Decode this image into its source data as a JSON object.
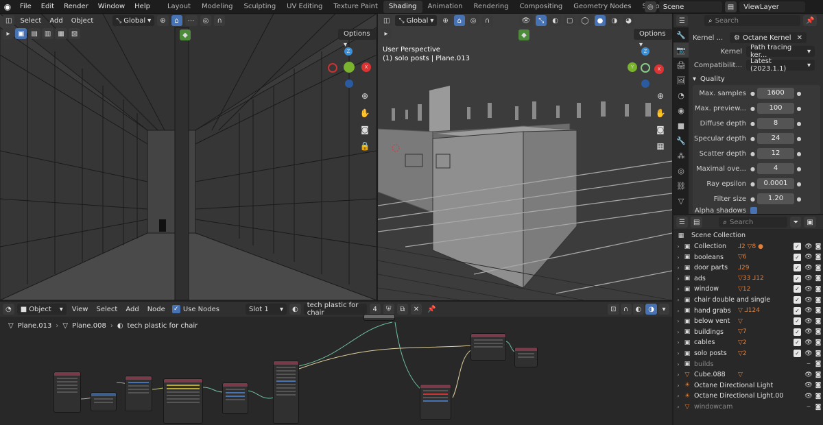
{
  "menu": {
    "items": [
      "File",
      "Edit",
      "Render",
      "Window",
      "Help"
    ]
  },
  "workspaces": {
    "tabs": [
      "Layout",
      "Modeling",
      "Sculpting",
      "UV Editing",
      "Texture Paint",
      "Shading",
      "Animation",
      "Rendering",
      "Compositing",
      "Geometry Nodes",
      "Scripting"
    ],
    "active": "Shading"
  },
  "scene": {
    "name": "Scene",
    "viewlayer": "ViewLayer"
  },
  "viewport_left": {
    "modes": [
      "Select",
      "Add",
      "Object"
    ],
    "orientation": "Global",
    "options_label": "Options"
  },
  "viewport_right": {
    "orientation": "Global",
    "options_label": "Options",
    "overlay_title": "User Perspective",
    "overlay_subtitle": "(1) solo posts | Plane.013"
  },
  "properties": {
    "search_placeholder": "Search",
    "kernel_label": "Kernel ...",
    "kernel_node": "Octane Kernel",
    "kernel_type_label": "Kernel",
    "kernel_type_value": "Path tracing ker...",
    "compat_label": "Compatibilit...",
    "compat_value": "Latest (2023.1.1)",
    "section_title": "Quality",
    "rows": [
      {
        "label": "Max. samples",
        "value": "1600"
      },
      {
        "label": "Max. preview...",
        "value": "100"
      },
      {
        "label": "Diffuse depth",
        "value": "8"
      },
      {
        "label": "Specular depth",
        "value": "24"
      },
      {
        "label": "Scatter depth",
        "value": "12"
      },
      {
        "label": "Maximal ove...",
        "value": "4"
      },
      {
        "label": "Ray epsilon",
        "value": "0.0001"
      },
      {
        "label": "Filter size",
        "value": "1.20"
      }
    ],
    "last_row": "Alpha shadows"
  },
  "outliner": {
    "search_placeholder": "Search",
    "root": "Scene Collection",
    "items": [
      {
        "name": "Collection",
        "extra": "⅃2 ▽8 ●",
        "dim": false,
        "checkbox": true
      },
      {
        "name": "booleans",
        "extra": "▽6",
        "dim": false,
        "checkbox": true
      },
      {
        "name": "door parts",
        "extra": "⅃29",
        "dim": false,
        "checkbox": true
      },
      {
        "name": "ads",
        "extra": "▽33 ⅃12",
        "dim": false,
        "checkbox": true
      },
      {
        "name": "window",
        "extra": "▽12",
        "dim": false,
        "checkbox": true
      },
      {
        "name": "chair double and single",
        "extra": "",
        "dim": false,
        "checkbox": true
      },
      {
        "name": "hand grabs",
        "extra": "▽ ⅃124",
        "dim": false,
        "checkbox": true
      },
      {
        "name": "below vent",
        "extra": "▽",
        "dim": false,
        "checkbox": true
      },
      {
        "name": "buildings",
        "extra": "▽7",
        "dim": false,
        "checkbox": true
      },
      {
        "name": "cables",
        "extra": "▽2",
        "dim": false,
        "checkbox": true
      },
      {
        "name": "solo posts",
        "extra": "▽2",
        "dim": false,
        "checkbox": true
      },
      {
        "name": "builds",
        "extra": "",
        "dim": true,
        "checkbox": false
      },
      {
        "name": "Cube.088",
        "extra": "▽",
        "dim": false,
        "checkbox": false
      },
      {
        "name": "Octane Directional Light",
        "extra": "",
        "dim": false,
        "checkbox": false
      },
      {
        "name": "Octane Directional Light.00",
        "extra": "",
        "dim": false,
        "checkbox": false
      },
      {
        "name": "windowcam",
        "extra": "",
        "dim": true,
        "checkbox": false
      }
    ]
  },
  "node_editor": {
    "object_mode": "Object",
    "menus": [
      "View",
      "Select",
      "Add",
      "Node"
    ],
    "use_nodes_label": "Use Nodes",
    "slot": "Slot 1",
    "material": "tech plastic for chair",
    "users": "4",
    "breadcrumb": [
      "Plane.013",
      "Plane.008",
      "tech plastic for chair"
    ]
  }
}
